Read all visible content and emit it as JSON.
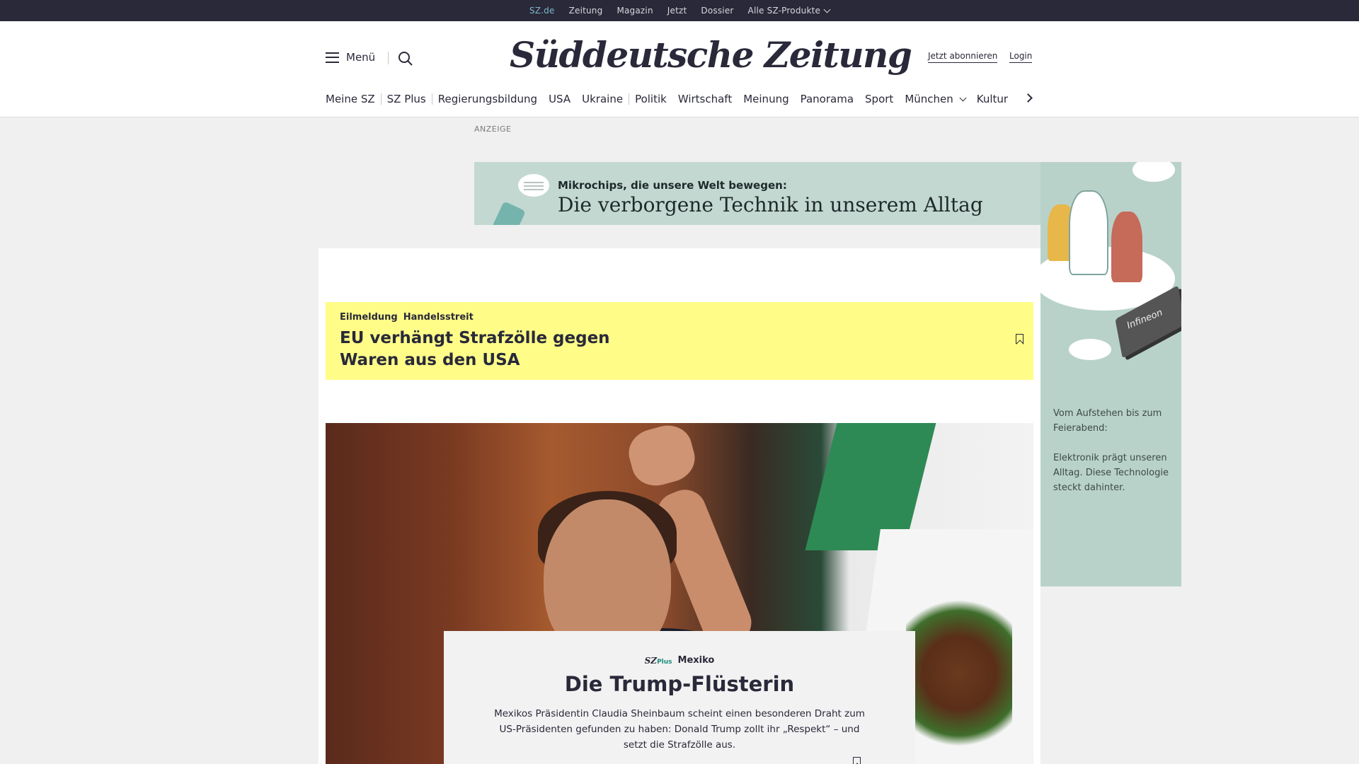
{
  "topbar": {
    "links": [
      "SZ.de",
      "Zeitung",
      "Magazin",
      "Jetzt",
      "Dossier",
      "Alle SZ-Produkte"
    ]
  },
  "header": {
    "menu_label": "Menü",
    "logo_text": "Süddeutsche Zeitung",
    "subscribe_label": "Jetzt abonnieren",
    "login_label": "Login"
  },
  "nav": {
    "items": [
      "Meine SZ",
      "SZ Plus",
      "Regierungsbildung",
      "USA",
      "Ukraine",
      "Politik",
      "Wirtschaft",
      "Meinung",
      "Panorama",
      "Sport",
      "München",
      "Kultur"
    ]
  },
  "ad": {
    "label": "ANZEIGE",
    "kicker": "Mikrochips, die unsere Welt bewegen:",
    "title": "Die verborgene Technik in unserem Alltag",
    "brand": "Infineon",
    "side_text_1": "Vom Aufstehen bis zum Feierabend:",
    "side_text_2": "Elektronik prägt unseren Alltag. Diese Technologie steckt dahinter."
  },
  "breaking": {
    "tag_1": "Eilmeldung",
    "tag_2": "Handelsstreit",
    "headline": "EU verhängt Strafzölle gegen Waren aus den USA"
  },
  "teaser": {
    "sz_plus_prefix": "SZ",
    "sz_plus_suffix": "Plus",
    "kicker": "Mexiko",
    "title": "Die Trump-Flüsterin",
    "description": "Mexikos Präsidentin Claudia Sheinbaum scheint einen besonderen Draht zum US-Präsidenten gefunden zu haben: Donald Trump zollt ihr „Respekt“ – und setzt die Strafzölle aus."
  },
  "colors": {
    "brand_dark": "#29293a",
    "breaking_bg": "#fffd88",
    "ad_bg": "#c3d8d1",
    "sz_plus_accent": "#1d8b7d",
    "active_link": "#7fb6c9"
  }
}
